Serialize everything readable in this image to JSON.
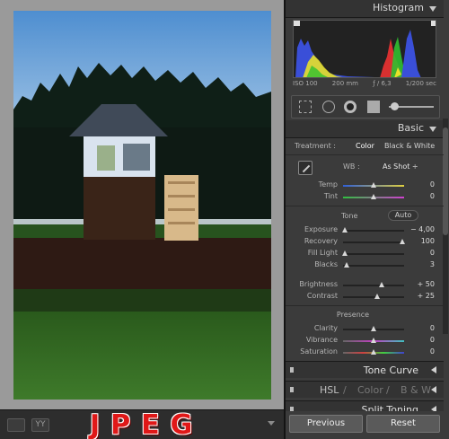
{
  "photo": {
    "colors": {
      "sky": "#6ea4d6",
      "trees": "#102018",
      "grass": "#2c6b24",
      "hedge": "#3a1e16"
    }
  },
  "toolbar": {
    "overlay_text": "JPEG",
    "icons": [
      "loupe-view-icon",
      "before-after-icon",
      "toolbar-menu-icon"
    ]
  },
  "histogram": {
    "title": "Histogram",
    "iso": "ISO 100",
    "focal": "200 mm",
    "aperture": "ƒ / 6,3",
    "shutter": "1/200 sec"
  },
  "basic": {
    "title": "Basic",
    "treatment_label": "Treatment :",
    "treatment_color": "Color",
    "treatment_bw": "Black & White",
    "wb_label": "WB :",
    "wb_value": "As Shot ÷",
    "temp": {
      "label": "Temp",
      "value": "0",
      "pos": 0.5
    },
    "tint": {
      "label": "Tint",
      "value": "0",
      "pos": 0.5
    },
    "tone_label": "Tone",
    "auto_label": "Auto",
    "exposure": {
      "label": "Exposure",
      "value": "− 4,00",
      "pos": 0.0
    },
    "recovery": {
      "label": "Recovery",
      "value": "100",
      "pos": 1.0
    },
    "fill_light": {
      "label": "Fill Light",
      "value": "0",
      "pos": 0.0
    },
    "blacks": {
      "label": "Blacks",
      "value": "3",
      "pos": 0.03
    },
    "brightness": {
      "label": "Brightness",
      "value": "+ 50",
      "pos": 0.63
    },
    "contrast": {
      "label": "Contrast",
      "value": "+ 25",
      "pos": 0.55
    },
    "presence_label": "Presence",
    "clarity": {
      "label": "Clarity",
      "value": "0",
      "pos": 0.5
    },
    "vibrance": {
      "label": "Vibrance",
      "value": "0",
      "pos": 0.5
    },
    "saturation": {
      "label": "Saturation",
      "value": "0",
      "pos": 0.5
    }
  },
  "panels": {
    "tone_curve": "Tone Curve",
    "hsl": "HSL",
    "color": "Color",
    "bw": "B & W",
    "split_toning": "Split Toning",
    "slash": "/"
  },
  "buttons": {
    "previous": "Previous",
    "reset": "Reset"
  }
}
